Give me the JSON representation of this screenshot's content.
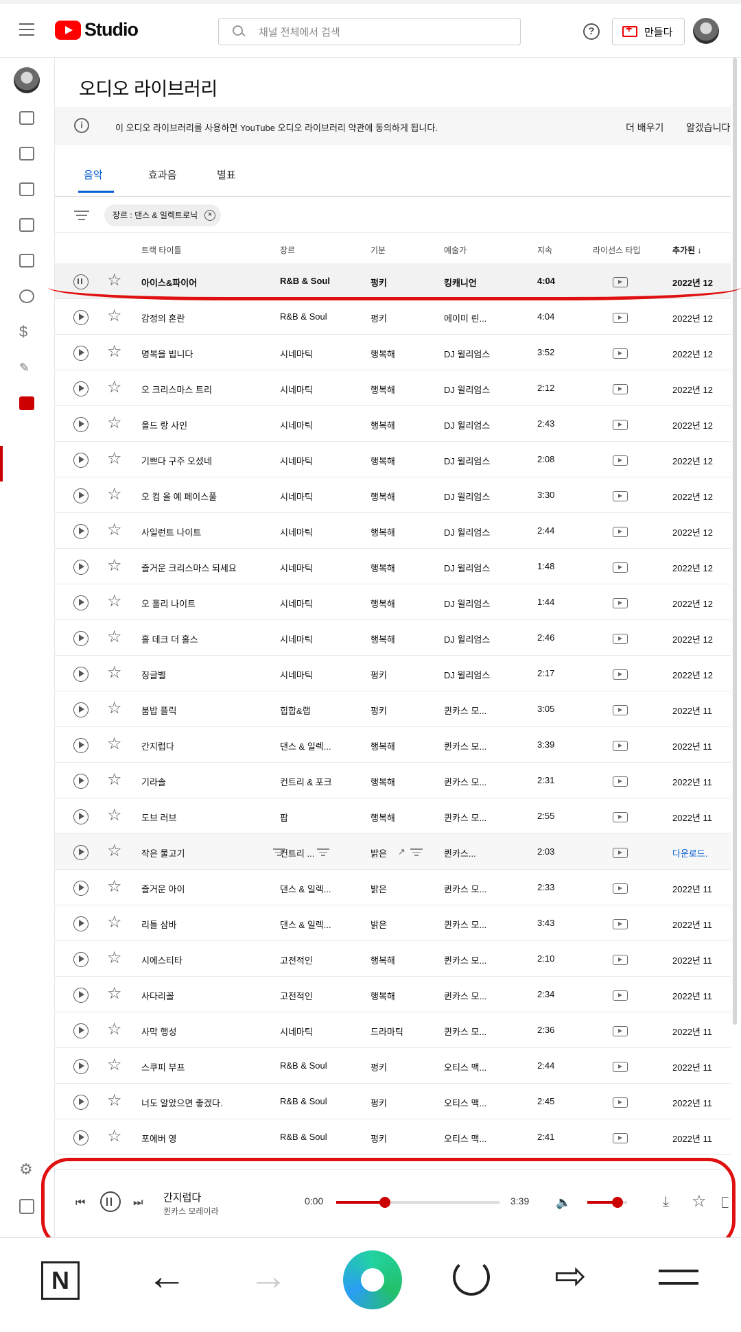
{
  "header": {
    "logo_text": "Studio",
    "search_placeholder": "채널 전체에서 검색",
    "help_symbol": "?",
    "create_label": "만들다"
  },
  "page": {
    "title": "오디오 라이브러리",
    "notice": {
      "info_symbol": "i",
      "message": "이 오디오 라이브러리를 사용하면 YouTube 오디오 라이브러리 약관에 동의하게 됩니다.",
      "learn_more": "더 배우기",
      "got_it": "알겠습니다"
    },
    "tabs": [
      "음악",
      "효과음",
      "별표"
    ],
    "active_tab": "음악",
    "filter_chip": "장르 : 댄스 & 일렉트로닉",
    "filter_clear_symbol": "×"
  },
  "table": {
    "columns": {
      "title": "트랙 타이틀",
      "genre": "장르",
      "mood": "기분",
      "artist": "예술가",
      "duration": "지속",
      "license": "라이선스 타입",
      "added": "추가된 ↓"
    },
    "rows": [
      {
        "title": "아이스&파이어",
        "genre": "R&B & Soul",
        "mood": "펑키",
        "artist": "킹캐니언",
        "duration": "4:04",
        "added": "2022년 12"
      },
      {
        "title": "감정의 혼란",
        "genre": "R&B & Soul",
        "mood": "펑키",
        "artist": "에이미 린...",
        "duration": "4:04",
        "added": "2022년 12"
      },
      {
        "title": "명복을 빕니다",
        "genre": "시네마틱",
        "mood": "행복해",
        "artist": "DJ 윌리엄스",
        "duration": "3:52",
        "added": "2022년 12"
      },
      {
        "title": "오 크리스마스 트리",
        "genre": "시네마틱",
        "mood": "행복해",
        "artist": "DJ 윌리엄스",
        "duration": "2:12",
        "added": "2022년 12"
      },
      {
        "title": "올드 랑 사인",
        "genre": "시네마틱",
        "mood": "행복해",
        "artist": "DJ 윌리엄스",
        "duration": "2:43",
        "added": "2022년 12"
      },
      {
        "title": "기쁘다 구주 오셨네",
        "genre": "시네마틱",
        "mood": "행복해",
        "artist": "DJ 윌리엄스",
        "duration": "2:08",
        "added": "2022년 12"
      },
      {
        "title": "오 컴 올 예 페이스풀",
        "genre": "시네마틱",
        "mood": "행복해",
        "artist": "DJ 윌리엄스",
        "duration": "3:30",
        "added": "2022년 12"
      },
      {
        "title": "사일런트 나이트",
        "genre": "시네마틱",
        "mood": "행복해",
        "artist": "DJ 윌리엄스",
        "duration": "2:44",
        "added": "2022년 12"
      },
      {
        "title": "즐거운 크리스마스 되세요",
        "genre": "시네마틱",
        "mood": "행복해",
        "artist": "DJ 윌리엄스",
        "duration": "1:48",
        "added": "2022년 12"
      },
      {
        "title": "오 홀리 나이트",
        "genre": "시네마틱",
        "mood": "행복해",
        "artist": "DJ 윌리엄스",
        "duration": "1:44",
        "added": "2022년 12"
      },
      {
        "title": "홀 데크 더 홀스",
        "genre": "시네마틱",
        "mood": "행복해",
        "artist": "DJ 윌리엄스",
        "duration": "2:46",
        "added": "2022년 12"
      },
      {
        "title": "징글벨",
        "genre": "시네마틱",
        "mood": "펑키",
        "artist": "DJ 윌리엄스",
        "duration": "2:17",
        "added": "2022년 12"
      },
      {
        "title": "붐밥 플릭",
        "genre": "힙합&랩",
        "mood": "펑키",
        "artist": "퀸카스 모...",
        "duration": "3:05",
        "added": "2022년 11"
      },
      {
        "title": "간지럽다",
        "genre": "댄스 & 일렉...",
        "mood": "행복해",
        "artist": "퀸카스 모...",
        "duration": "3:39",
        "added": "2022년 11"
      },
      {
        "title": "기라솔",
        "genre": "컨트리 & 포크",
        "mood": "행복해",
        "artist": "퀸카스 모...",
        "duration": "2:31",
        "added": "2022년 11"
      },
      {
        "title": "도브 러브",
        "genre": "팝",
        "mood": "행복해",
        "artist": "퀸카스 모...",
        "duration": "2:55",
        "added": "2022년 11"
      },
      {
        "title": "작은 물고기",
        "genre": "컨트리 ...",
        "mood": "밝은",
        "artist": "퀸카스...",
        "duration": "2:03",
        "added": "다운로드."
      },
      {
        "title": "즐거운 아이",
        "genre": "댄스 & 일렉...",
        "mood": "밝은",
        "artist": "퀸카스 모...",
        "duration": "2:33",
        "added": "2022년 11"
      },
      {
        "title": "리틀 삼바",
        "genre": "댄스 & 일렉...",
        "mood": "밝은",
        "artist": "퀸카스 모...",
        "duration": "3:43",
        "added": "2022년 11"
      },
      {
        "title": "시에스티타",
        "genre": "고전적인",
        "mood": "행복해",
        "artist": "퀸카스 모...",
        "duration": "2:10",
        "added": "2022년 11"
      },
      {
        "title": "사다리꼴",
        "genre": "고전적인",
        "mood": "행복해",
        "artist": "퀸카스 모...",
        "duration": "2:34",
        "added": "2022년 11"
      },
      {
        "title": "사막 행성",
        "genre": "시네마틱",
        "mood": "드라마틱",
        "artist": "퀸카스 모...",
        "duration": "2:36",
        "added": "2022년 11"
      },
      {
        "title": "스쿠피 부프",
        "genre": "R&B & Soul",
        "mood": "펑키",
        "artist": "오티스 맥...",
        "duration": "2:44",
        "added": "2022년 11"
      },
      {
        "title": "너도 알았으면 좋겠다.",
        "genre": "R&B & Soul",
        "mood": "펑키",
        "artist": "오티스 맥...",
        "duration": "2:45",
        "added": "2022년 11"
      },
      {
        "title": "포에버 영",
        "genre": "R&B & Soul",
        "mood": "펑키",
        "artist": "오티스 맥...",
        "duration": "2:41",
        "added": "2022년 11"
      }
    ]
  },
  "player": {
    "title": "간지럽다",
    "artist": "퀸카스 모레이라",
    "elapsed": "0:00",
    "total": "3:39",
    "progress_fraction": 0.3,
    "volume_fraction": 0.75
  },
  "browser_nav": {
    "n_label": "N"
  }
}
